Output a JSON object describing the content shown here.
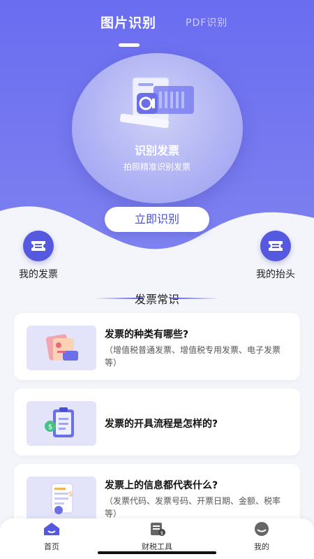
{
  "tabs": {
    "image_recognition": "图片识别",
    "pdf_recognition": "PDF识别"
  },
  "hero": {
    "title": "识别发票",
    "subtitle": "拍照精准识别发票",
    "button": "立即识别"
  },
  "quick_actions": {
    "my_invoices": "我的发票",
    "my_headers": "我的抬头"
  },
  "section": {
    "title": "发票常识"
  },
  "articles": [
    {
      "title": "发票的种类有哪些?",
      "desc": "（增值税普通发票、增值税专用发票、电子发票等）"
    },
    {
      "title": "发票的开具流程是怎样的?",
      "desc": ""
    },
    {
      "title": "发票上的信息都代表什么?",
      "desc": "（发票代码、发票号码、开票日期、金额、税率等）"
    }
  ],
  "nav": {
    "home": "首页",
    "tax_tools": "财税工具",
    "mine": "我的"
  },
  "colors": {
    "primary": "#5559e0",
    "hero_bg": "#6a6df0"
  }
}
